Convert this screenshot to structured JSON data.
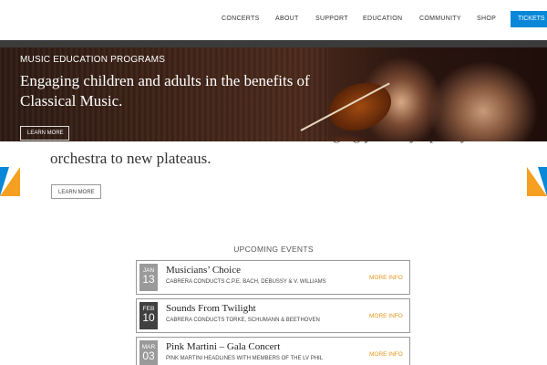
{
  "nav": {
    "items": [
      "CONCERTS",
      "ABOUT",
      "SUPPORT",
      "EDUCATION",
      "COMMUNITY",
      "SHOP"
    ],
    "tickets_label": "TICKETS"
  },
  "hero": {
    "label": "MUSIC EDUCATION PROGRAMS",
    "headline": "Engaging children and adults in the benefits of Classical Music.",
    "button_label": "LEARN MORE"
  },
  "background_slide": {
    "line1_partial": "Carlos Cabrera & Lorin Lee Carmichael, bringing youth symphony",
    "line2": "orchestra to new plateaus.",
    "button_label": "LEARN MORE"
  },
  "colors": {
    "accent_blue": "#0a88d8",
    "accent_orange": "#f5a020",
    "more_info": "#e8951a"
  },
  "events": {
    "heading": "UPCOMING EVENTS",
    "items": [
      {
        "month": "JAN",
        "day": "13",
        "title": "Musicians’ Choice",
        "subtitle": "CABRERA CONDUCTS C.P.E. BACH, DEBUSSY & V. WILLIAMS",
        "more": "MORE INFO"
      },
      {
        "month": "FEB",
        "day": "10",
        "title": "Sounds From Twilight",
        "subtitle": "CABRERA CONDUCTS TORKE, SCHUMANN & BEETHOVEN",
        "more": "MORE INFO"
      },
      {
        "month": "MAR",
        "day": "03",
        "title": "Pink Martini – Gala Concert",
        "subtitle": "PINK MARTINI HEADLINES WITH MEMBERS OF THE LV PHIL",
        "more": "MORE INFO"
      }
    ]
  }
}
